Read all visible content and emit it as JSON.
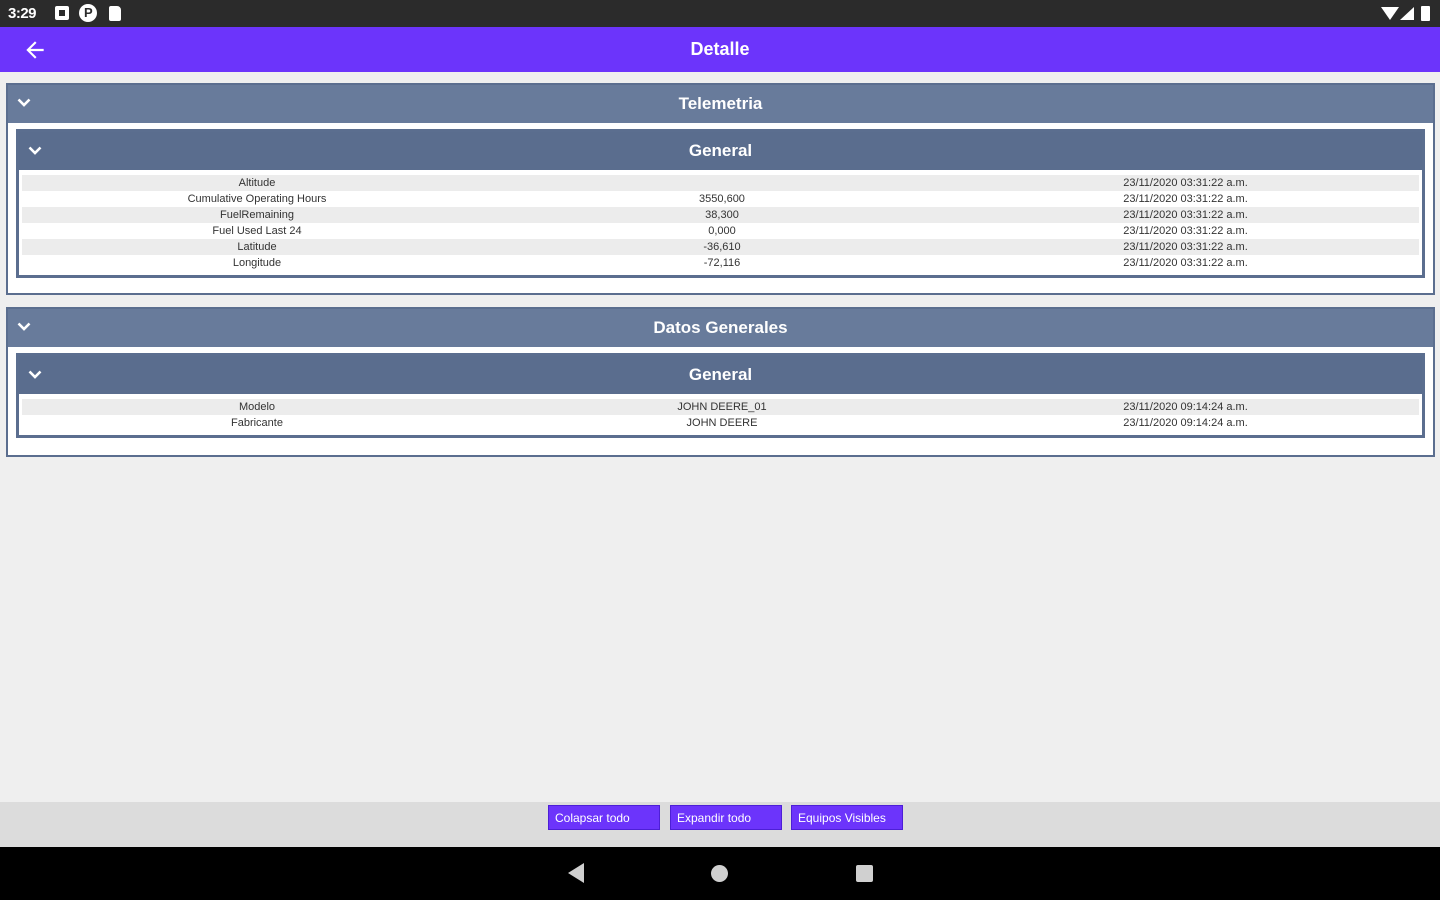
{
  "status_bar": {
    "time": "3:29",
    "icons": [
      "notification-square-icon",
      "p-circle-icon",
      "sd-card-icon",
      "wifi-icon",
      "signal-icon",
      "battery-icon"
    ]
  },
  "app_bar": {
    "title": "Detalle",
    "back_icon": "arrow-left-icon",
    "background": "#6c34fb"
  },
  "sections": [
    {
      "title": "Telemetria",
      "groups": [
        {
          "title": "General",
          "rows": [
            [
              "Altitude",
              "",
              "23/11/2020 03:31:22 a.m."
            ],
            [
              "Cumulative Operating Hours",
              "3550,600",
              "23/11/2020 03:31:22 a.m."
            ],
            [
              "FuelRemaining",
              "38,300",
              "23/11/2020 03:31:22 a.m."
            ],
            [
              "Fuel Used Last 24",
              "0,000",
              "23/11/2020 03:31:22 a.m."
            ],
            [
              "Latitude",
              "-36,610",
              "23/11/2020 03:31:22 a.m."
            ],
            [
              "Longitude",
              "-72,116",
              "23/11/2020 03:31:22 a.m."
            ]
          ]
        }
      ]
    },
    {
      "title": "Datos Generales",
      "groups": [
        {
          "title": "General",
          "rows": [
            [
              "Modelo",
              "JOHN DEERE_01",
              "23/11/2020 09:14:24 a.m."
            ],
            [
              "Fabricante",
              "JOHN DEERE",
              "23/11/2020 09:14:24 a.m."
            ]
          ]
        }
      ]
    }
  ],
  "bottom_bar": {
    "collapse_label": "Colapsar todo",
    "expand_label": "Expandir todo",
    "visible_label": "Equipos Visibles"
  },
  "nav_bar": {
    "icons": [
      "nav-back-icon",
      "nav-home-icon",
      "nav-recents-icon"
    ]
  },
  "colors": {
    "accent": "#6c34fb",
    "section_header": "#687b9b",
    "group_header": "#5a6d8e"
  }
}
